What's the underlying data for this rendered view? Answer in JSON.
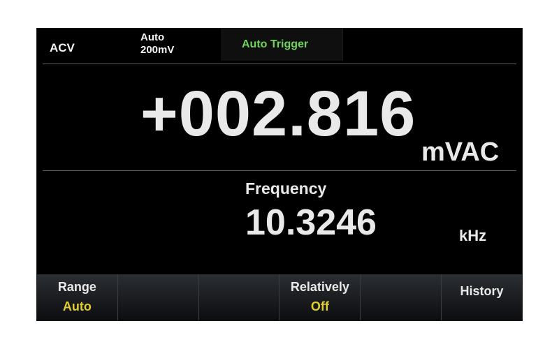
{
  "status": {
    "mode": "ACV",
    "range_line1": "Auto",
    "range_line2": "200mV",
    "trigger": "Auto Trigger"
  },
  "main": {
    "value": "+002.816",
    "unit": "mVAC"
  },
  "secondary": {
    "label": "Frequency",
    "value": "10.3246",
    "unit": "kHz"
  },
  "softkeys": [
    {
      "label": "Range",
      "value": "Auto"
    },
    {
      "label": "",
      "value": ""
    },
    {
      "label": "",
      "value": ""
    },
    {
      "label": "Relatively",
      "value": "Off"
    },
    {
      "label": "",
      "value": ""
    },
    {
      "label": "History",
      "value": ""
    }
  ],
  "colors": {
    "trigger": "#6fd45a",
    "softkey_value": "#e3cf2a",
    "text": "#e9e9e9",
    "background": "#000000"
  }
}
